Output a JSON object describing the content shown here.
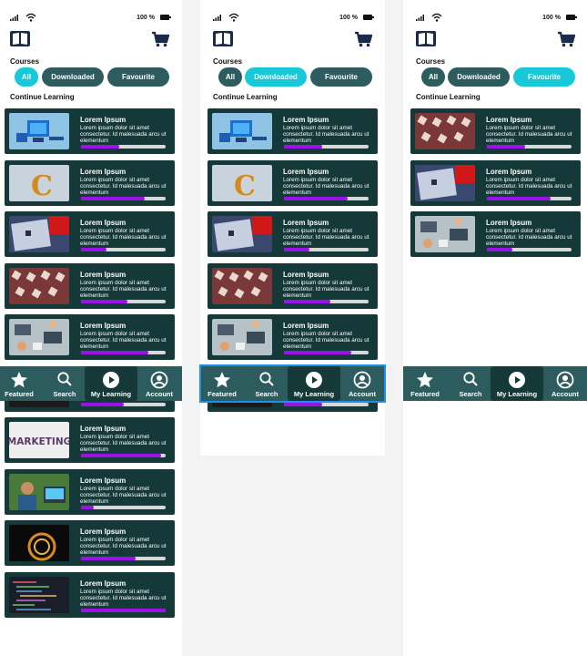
{
  "status": {
    "battery_text": "100 %"
  },
  "header": {
    "logo_icon": "book-icon",
    "cart_icon": "cart-icon"
  },
  "courses_label": "Courses",
  "filters": [
    "All",
    "Downloaded",
    "Favourite"
  ],
  "continue_label": "Continue Learning",
  "card_text": {
    "title": "Lorem Ipsum",
    "description": "Lorem ipsum dolor sit amet consectetur. Id malesuada arcu ut elementum"
  },
  "nav": {
    "featured": "Featured",
    "search": "Search",
    "my_learning": "My Learning",
    "account": "Account"
  },
  "screens": [
    {
      "active_filter": "All",
      "progress": [
        0.45,
        0.75,
        0.3,
        0.55,
        0.8,
        0.5,
        0.95,
        0.15,
        0.65,
        1.0
      ]
    },
    {
      "active_filter": "Downloaded",
      "progress": [
        0.45,
        0.75,
        0.3,
        0.55,
        0.8
      ]
    },
    {
      "active_filter": "Favourite",
      "progress": [
        0.45,
        0.75,
        0.3
      ]
    }
  ],
  "colors": {
    "primary": "#2c5c5e",
    "card": "#153838",
    "accent": "#16c8d8",
    "progress": "#9a12e6",
    "highlight": "#1e90e8"
  }
}
